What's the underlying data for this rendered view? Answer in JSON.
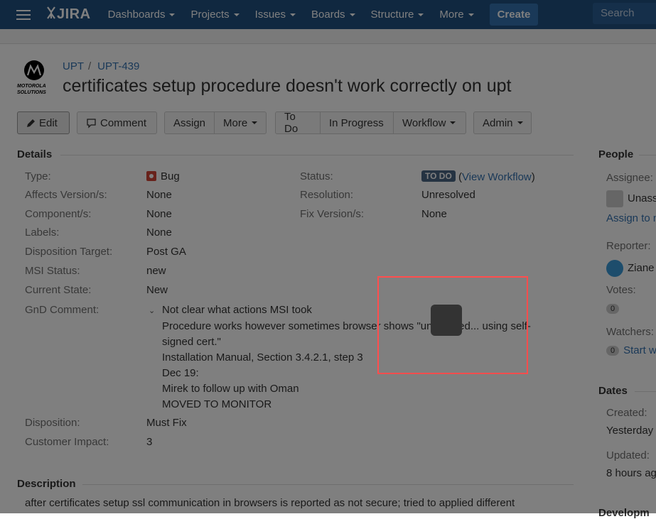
{
  "nav": {
    "logo_text": "JIRA",
    "items": [
      "Dashboards",
      "Projects",
      "Issues",
      "Boards",
      "Structure",
      "More"
    ],
    "create_label": "Create",
    "search_placeholder": "Search"
  },
  "project": {
    "avatar_text": "MOTOROLA SOLUTIONS",
    "key": "UPT",
    "issue_key": "UPT-439",
    "title": "certificates setup procedure doesn't work correctly on upt"
  },
  "toolbar": {
    "edit": "Edit",
    "comment": "Comment",
    "assign": "Assign",
    "more": "More",
    "todo": "To Do",
    "in_progress": "In Progress",
    "workflow": "Workflow",
    "admin": "Admin"
  },
  "details": {
    "heading": "Details",
    "type_label": "Type:",
    "type_value": "Bug",
    "affects_label": "Affects Version/s:",
    "affects_value": "None",
    "component_label": "Component/s:",
    "component_value": "None",
    "labels_label": "Labels:",
    "labels_value": "None",
    "disposition_target_label": "Disposition Target:",
    "disposition_target_value": "Post GA",
    "msi_status_label": "MSI Status:",
    "msi_status_value": "new",
    "current_state_label": "Current State:",
    "current_state_value": "New",
    "gnd_label": "GnD Comment:",
    "gnd_lines": [
      "Not clear what actions MSI took",
      "Procedure works however sometimes browser shows \"unsecured... using self-",
      "signed cert.\"",
      "Installation Manual, Section 3.4.2.1, step 3",
      "Dec 19:",
      "Mirek to follow up with Oman",
      "MOVED TO MONITOR"
    ],
    "disposition_label": "Disposition:",
    "disposition_value": "Must Fix",
    "customer_impact_label": "Customer Impact:",
    "customer_impact_value": "3",
    "status_label": "Status:",
    "status_value": "TO DO",
    "view_workflow_open": "(",
    "view_workflow": "View Workflow",
    "view_workflow_close": ")",
    "resolution_label": "Resolution:",
    "resolution_value": "Unresolved",
    "fix_version_label": "Fix Version/s:",
    "fix_version_value": "None"
  },
  "description": {
    "heading": "Description",
    "text": "after certificates setup ssl communication in browsers is reported as not secure; tried to applied different"
  },
  "people": {
    "heading": "People",
    "assignee_label": "Assignee:",
    "assignee_value": "Unass",
    "assign_to_me": "Assign to m",
    "reporter_label": "Reporter:",
    "reporter_value": "Ziane",
    "votes_label": "Votes:",
    "votes_count": "0",
    "watchers_label": "Watchers:",
    "watchers_count": "0",
    "start_watching": "Start w"
  },
  "dates": {
    "heading": "Dates",
    "created_label": "Created:",
    "created_value": "Yesterday",
    "updated_label": "Updated:",
    "updated_value": "8 hours ag"
  },
  "development": {
    "heading": "Developm"
  },
  "colors": {
    "nav_bg": "#205081",
    "create_bg": "#3572b0",
    "link": "#3572b0",
    "highlight": "#ff4d4d",
    "bug": "#d04437",
    "status": "#4a6785"
  }
}
